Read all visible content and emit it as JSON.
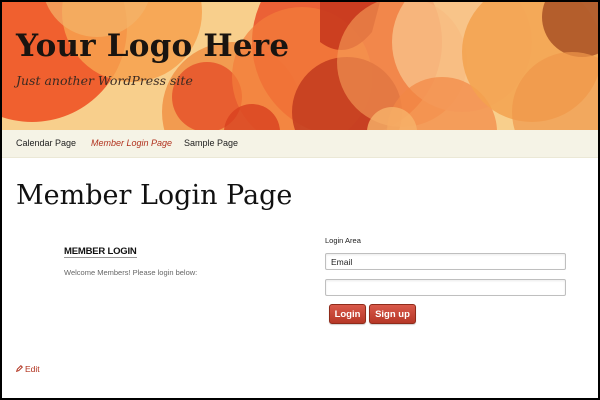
{
  "site": {
    "title": "Your Logo Here",
    "description": "Just another WordPress site"
  },
  "nav": {
    "items": [
      {
        "label": "Calendar Page",
        "active": false
      },
      {
        "label": "Member Login Page",
        "active": true
      },
      {
        "label": "Sample Page",
        "active": false
      }
    ]
  },
  "page": {
    "title": "Member Login Page"
  },
  "widget": {
    "title": "Member Login",
    "text": "Welcome Members! Please login below:"
  },
  "login": {
    "area_label": "Login Area",
    "email_value": "Email",
    "password_value": "",
    "login_label": "Login",
    "signup_label": "Sign up"
  },
  "edit": {
    "label": "Edit",
    "icon": "pencil-icon"
  },
  "colors": {
    "accent": "#b1321e",
    "button": "#c8463a",
    "nav_bg": "#f5f3e6"
  }
}
